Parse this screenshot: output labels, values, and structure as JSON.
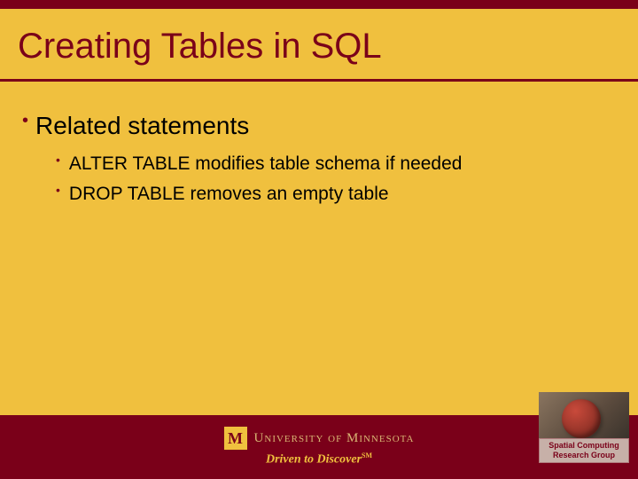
{
  "title": "Creating Tables in SQL",
  "bullets": {
    "main": "Related statements",
    "subs": [
      "ALTER TABLE modifies table schema if needed",
      "DROP TABLE removes an empty table"
    ]
  },
  "footer": {
    "university": "University of Minnesota",
    "tagline": "Driven to Discover",
    "taglineMark": "SM"
  },
  "badge": {
    "line1": "Spatial Computing",
    "line2": "Research Group"
  }
}
